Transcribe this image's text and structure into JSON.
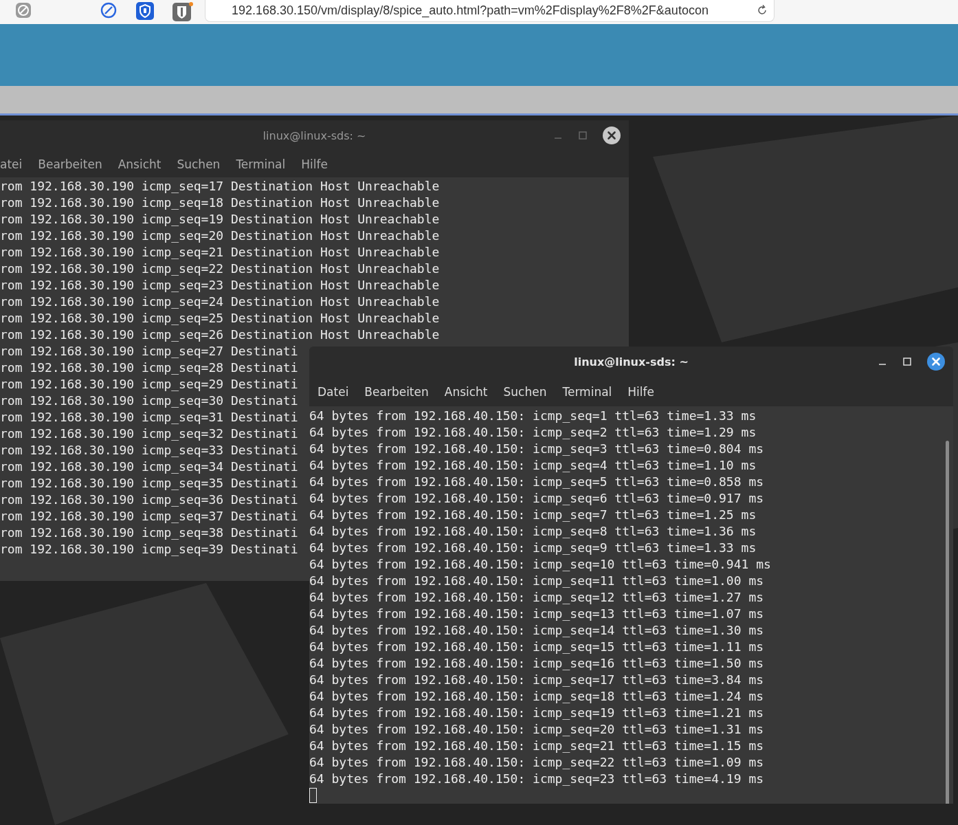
{
  "browser": {
    "url": "192.168.30.150/vm/display/8/spice_auto.html?path=vm%2Fdisplay%2F8%2F&autocon"
  },
  "windows": [
    {
      "title": "linux@linux-sds: ~",
      "focused": false,
      "cursor": false,
      "menu": [
        "atei",
        "Bearbeiten",
        "Ansicht",
        "Suchen",
        "Terminal",
        "Hilfe"
      ],
      "lines": [
        "rom 192.168.30.190 icmp_seq=17 Destination Host Unreachable",
        "rom 192.168.30.190 icmp_seq=18 Destination Host Unreachable",
        "rom 192.168.30.190 icmp_seq=19 Destination Host Unreachable",
        "rom 192.168.30.190 icmp_seq=20 Destination Host Unreachable",
        "rom 192.168.30.190 icmp_seq=21 Destination Host Unreachable",
        "rom 192.168.30.190 icmp_seq=22 Destination Host Unreachable",
        "rom 192.168.30.190 icmp_seq=23 Destination Host Unreachable",
        "rom 192.168.30.190 icmp_seq=24 Destination Host Unreachable",
        "rom 192.168.30.190 icmp_seq=25 Destination Host Unreachable",
        "rom 192.168.30.190 icmp_seq=26 Destination Host Unreachable",
        "rom 192.168.30.190 icmp_seq=27 Destinati",
        "rom 192.168.30.190 icmp_seq=28 Destinati",
        "rom 192.168.30.190 icmp_seq=29 Destinati",
        "rom 192.168.30.190 icmp_seq=30 Destinati",
        "rom 192.168.30.190 icmp_seq=31 Destinati",
        "rom 192.168.30.190 icmp_seq=32 Destinati",
        "rom 192.168.30.190 icmp_seq=33 Destinati",
        "rom 192.168.30.190 icmp_seq=34 Destinati",
        "rom 192.168.30.190 icmp_seq=35 Destinati",
        "rom 192.168.30.190 icmp_seq=36 Destinati",
        "rom 192.168.30.190 icmp_seq=37 Destinati",
        "rom 192.168.30.190 icmp_seq=38 Destinati",
        "rom 192.168.30.190 icmp_seq=39 Destinati"
      ]
    },
    {
      "title": "linux@linux-sds: ~",
      "focused": true,
      "cursor": true,
      "menu": [
        "Datei",
        "Bearbeiten",
        "Ansicht",
        "Suchen",
        "Terminal",
        "Hilfe"
      ],
      "lines": [
        "64 bytes from 192.168.40.150: icmp_seq=1 ttl=63 time=1.33 ms",
        "64 bytes from 192.168.40.150: icmp_seq=2 ttl=63 time=1.29 ms",
        "64 bytes from 192.168.40.150: icmp_seq=3 ttl=63 time=0.804 ms",
        "64 bytes from 192.168.40.150: icmp_seq=4 ttl=63 time=1.10 ms",
        "64 bytes from 192.168.40.150: icmp_seq=5 ttl=63 time=0.858 ms",
        "64 bytes from 192.168.40.150: icmp_seq=6 ttl=63 time=0.917 ms",
        "64 bytes from 192.168.40.150: icmp_seq=7 ttl=63 time=1.25 ms",
        "64 bytes from 192.168.40.150: icmp_seq=8 ttl=63 time=1.36 ms",
        "64 bytes from 192.168.40.150: icmp_seq=9 ttl=63 time=1.33 ms",
        "64 bytes from 192.168.40.150: icmp_seq=10 ttl=63 time=0.941 ms",
        "64 bytes from 192.168.40.150: icmp_seq=11 ttl=63 time=1.00 ms",
        "64 bytes from 192.168.40.150: icmp_seq=12 ttl=63 time=1.27 ms",
        "64 bytes from 192.168.40.150: icmp_seq=13 ttl=63 time=1.07 ms",
        "64 bytes from 192.168.40.150: icmp_seq=14 ttl=63 time=1.30 ms",
        "64 bytes from 192.168.40.150: icmp_seq=15 ttl=63 time=1.11 ms",
        "64 bytes from 192.168.40.150: icmp_seq=16 ttl=63 time=1.50 ms",
        "64 bytes from 192.168.40.150: icmp_seq=17 ttl=63 time=3.84 ms",
        "64 bytes from 192.168.40.150: icmp_seq=18 ttl=63 time=1.24 ms",
        "64 bytes from 192.168.40.150: icmp_seq=19 ttl=63 time=1.21 ms",
        "64 bytes from 192.168.40.150: icmp_seq=20 ttl=63 time=1.31 ms",
        "64 bytes from 192.168.40.150: icmp_seq=21 ttl=63 time=1.15 ms",
        "64 bytes from 192.168.40.150: icmp_seq=22 ttl=63 time=1.09 ms",
        "64 bytes from 192.168.40.150: icmp_seq=23 ttl=63 time=4.19 ms"
      ]
    }
  ]
}
